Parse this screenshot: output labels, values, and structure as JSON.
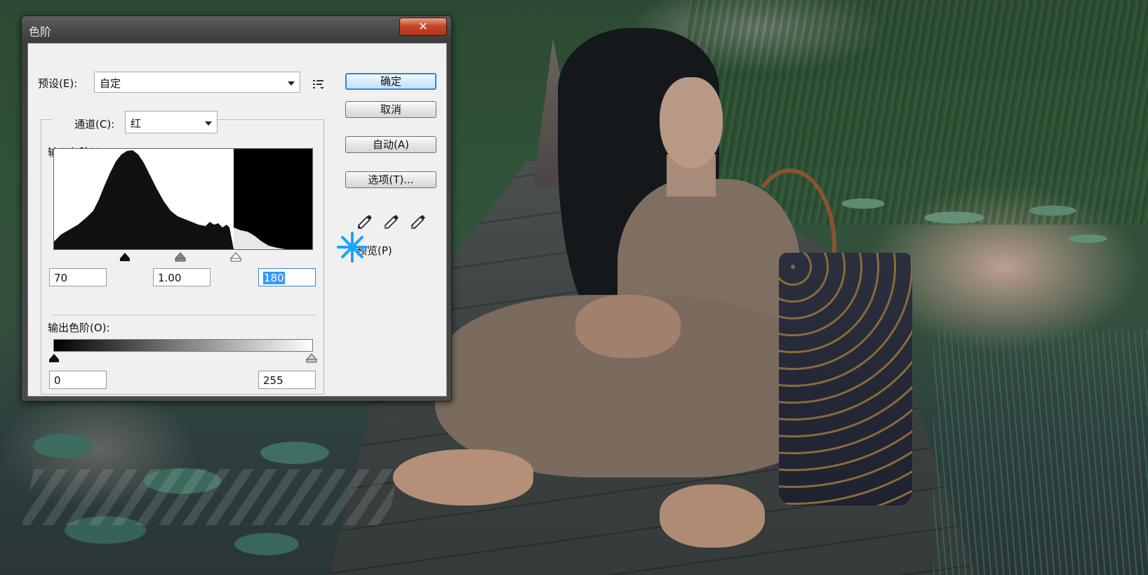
{
  "dialog": {
    "title": "色阶",
    "close_label": "✕",
    "preset_label": "预设(E):",
    "preset_value": "自定",
    "channel_label": "通道(C):",
    "channel_value": "红",
    "input_levels_label": "输入色阶(I):",
    "input_black": "70",
    "input_gamma": "1.00",
    "input_white": "180",
    "output_levels_label": "输出色阶(O):",
    "output_black": "0",
    "output_white": "255",
    "buttons": {
      "ok": "确定",
      "cancel": "取消",
      "auto": "自动(A)",
      "options": "选项(T)..."
    },
    "preview_label": "预览(P)",
    "preview_checked": true,
    "icons": {
      "preset_menu": "preset-menu-icon",
      "black_eyedropper": "black-eyedropper-icon",
      "gray_eyedropper": "gray-eyedropper-icon",
      "white_eyedropper": "white-eyedropper-icon",
      "cursor": "busy-cursor-icon"
    },
    "colors": {
      "accent": "#3b83c9",
      "close": "#c8482a",
      "selection": "#3399ff"
    }
  }
}
